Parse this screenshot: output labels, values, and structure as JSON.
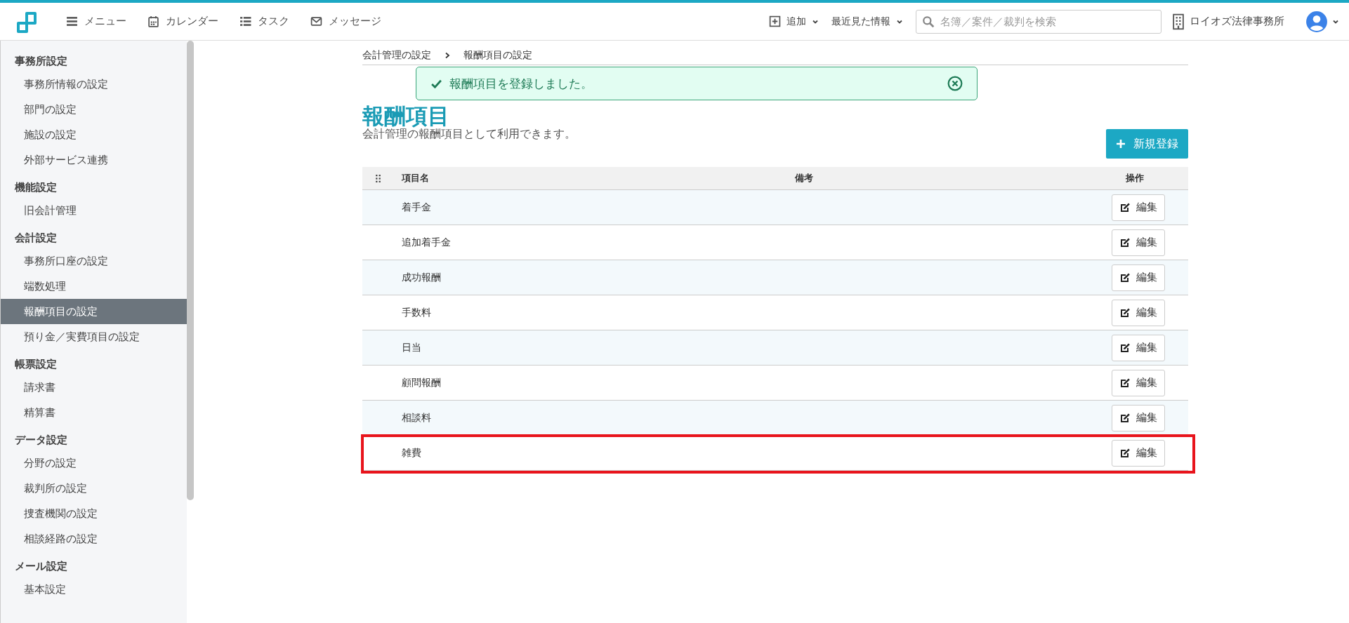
{
  "topbar": {
    "nav": [
      {
        "label": "メニュー"
      },
      {
        "label": "カレンダー"
      },
      {
        "label": "タスク"
      },
      {
        "label": "メッセージ"
      }
    ],
    "add": "追加",
    "recent": "最近見た情報",
    "search": {
      "placeholder": "名簿／案件／裁判を検索"
    },
    "office": "ロイオズ法律事務所"
  },
  "sidebar": [
    {
      "heading": "事務所設定",
      "items": [
        {
          "label": "事務所情報の設定",
          "selected": false
        },
        {
          "label": "部門の設定",
          "selected": false
        },
        {
          "label": "施設の設定",
          "selected": false
        },
        {
          "label": "外部サービス連携",
          "selected": false
        }
      ]
    },
    {
      "heading": "機能設定",
      "items": [
        {
          "label": "旧会計管理",
          "selected": false
        }
      ]
    },
    {
      "heading": "会計設定",
      "items": [
        {
          "label": "事務所口座の設定",
          "selected": false
        },
        {
          "label": "端数処理",
          "selected": false
        },
        {
          "label": "報酬項目の設定",
          "selected": true
        },
        {
          "label": "預り金／実費項目の設定",
          "selected": false
        }
      ]
    },
    {
      "heading": "帳票設定",
      "items": [
        {
          "label": "請求書",
          "selected": false
        },
        {
          "label": "精算書",
          "selected": false
        }
      ]
    },
    {
      "heading": "データ設定",
      "items": [
        {
          "label": "分野の設定",
          "selected": false
        },
        {
          "label": "裁判所の設定",
          "selected": false
        },
        {
          "label": "捜査機関の設定",
          "selected": false
        },
        {
          "label": "相談経路の設定",
          "selected": false
        }
      ]
    },
    {
      "heading": "メール設定",
      "items": [
        {
          "label": "基本設定",
          "selected": false
        }
      ]
    }
  ],
  "breadcrumb": [
    "会計管理の設定",
    "報酬項目の設定"
  ],
  "toast": {
    "message": "報酬項目を登録しました。"
  },
  "title": "報酬項目",
  "description": "会計管理の報酬項目として利用できます。",
  "new_button": "新規登録",
  "table": {
    "columns": [
      "項目名",
      "備考",
      "操作"
    ],
    "rows": [
      {
        "name": "着手金",
        "action": "編集",
        "highlighted": false
      },
      {
        "name": "追加着手金",
        "action": "編集",
        "highlighted": false
      },
      {
        "name": "成功報酬",
        "action": "編集",
        "highlighted": false
      },
      {
        "name": "手数料",
        "action": "編集",
        "highlighted": false
      },
      {
        "name": "日当",
        "action": "編集",
        "highlighted": false
      },
      {
        "name": "顧問報酬",
        "action": "編集",
        "highlighted": false
      },
      {
        "name": "相談料",
        "action": "編集",
        "highlighted": false
      },
      {
        "name": "雑費",
        "action": "編集",
        "highlighted": true
      }
    ]
  }
}
